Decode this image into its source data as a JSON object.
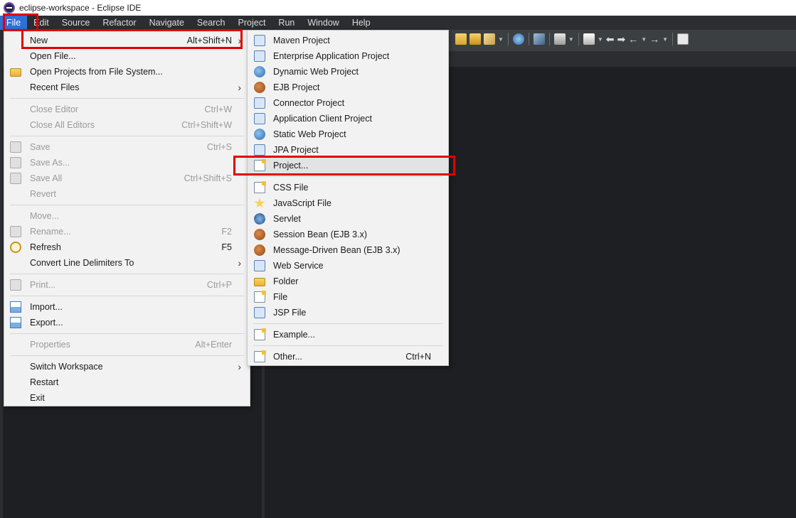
{
  "titlebar": {
    "title": "eclipse-workspace - Eclipse IDE"
  },
  "menubar": [
    "File",
    "Edit",
    "Source",
    "Refactor",
    "Navigate",
    "Search",
    "Project",
    "Run",
    "Window",
    "Help"
  ],
  "file_menu": {
    "items": [
      {
        "label": "New",
        "shortcut": "Alt+Shift+N",
        "submenu": true,
        "disabled": false,
        "icon": ""
      },
      {
        "label": "Open File...",
        "shortcut": "",
        "submenu": false,
        "disabled": false,
        "icon": ""
      },
      {
        "label": "Open Projects from File System...",
        "shortcut": "",
        "submenu": false,
        "disabled": false,
        "icon": "folder-icon"
      },
      {
        "label": "Recent Files",
        "shortcut": "",
        "submenu": true,
        "disabled": false,
        "icon": ""
      },
      {
        "label": "Close Editor",
        "shortcut": "Ctrl+W",
        "submenu": false,
        "disabled": true,
        "icon": ""
      },
      {
        "label": "Close All Editors",
        "shortcut": "Ctrl+Shift+W",
        "submenu": false,
        "disabled": true,
        "icon": ""
      },
      {
        "label": "Save",
        "shortcut": "Ctrl+S",
        "submenu": false,
        "disabled": true,
        "icon": "save-icon"
      },
      {
        "label": "Save As...",
        "shortcut": "",
        "submenu": false,
        "disabled": true,
        "icon": "save-as-icon"
      },
      {
        "label": "Save All",
        "shortcut": "Ctrl+Shift+S",
        "submenu": false,
        "disabled": true,
        "icon": "save-all-icon"
      },
      {
        "label": "Revert",
        "shortcut": "",
        "submenu": false,
        "disabled": true,
        "icon": ""
      },
      {
        "label": "Move...",
        "shortcut": "",
        "submenu": false,
        "disabled": true,
        "icon": ""
      },
      {
        "label": "Rename...",
        "shortcut": "F2",
        "submenu": false,
        "disabled": true,
        "icon": "rename-icon"
      },
      {
        "label": "Refresh",
        "shortcut": "F5",
        "submenu": false,
        "disabled": false,
        "icon": "refresh-icon"
      },
      {
        "label": "Convert Line Delimiters To",
        "shortcut": "",
        "submenu": true,
        "disabled": false,
        "icon": ""
      },
      {
        "label": "Print...",
        "shortcut": "Ctrl+P",
        "submenu": false,
        "disabled": true,
        "icon": "print-icon"
      },
      {
        "label": "Import...",
        "shortcut": "",
        "submenu": false,
        "disabled": false,
        "icon": "import-icon"
      },
      {
        "label": "Export...",
        "shortcut": "",
        "submenu": false,
        "disabled": false,
        "icon": "export-icon"
      },
      {
        "label": "Properties",
        "shortcut": "Alt+Enter",
        "submenu": false,
        "disabled": true,
        "icon": ""
      },
      {
        "label": "Switch Workspace",
        "shortcut": "",
        "submenu": true,
        "disabled": false,
        "icon": ""
      },
      {
        "label": "Restart",
        "shortcut": "",
        "submenu": false,
        "disabled": false,
        "icon": ""
      },
      {
        "label": "Exit",
        "shortcut": "",
        "submenu": false,
        "disabled": false,
        "icon": ""
      }
    ]
  },
  "new_menu": {
    "items": [
      {
        "label": "Maven Project",
        "shortcut": "",
        "icon": "maven-project-icon"
      },
      {
        "label": "Enterprise Application Project",
        "shortcut": "",
        "icon": "enterprise-application-project-icon"
      },
      {
        "label": "Dynamic Web Project",
        "shortcut": "",
        "icon": "dynamic-web-project-icon"
      },
      {
        "label": "EJB Project",
        "shortcut": "",
        "icon": "ejb-project-icon"
      },
      {
        "label": "Connector Project",
        "shortcut": "",
        "icon": "connector-project-icon"
      },
      {
        "label": "Application Client Project",
        "shortcut": "",
        "icon": "application-client-project-icon"
      },
      {
        "label": "Static Web Project",
        "shortcut": "",
        "icon": "static-web-project-icon"
      },
      {
        "label": "JPA Project",
        "shortcut": "",
        "icon": "jpa-project-icon"
      },
      {
        "label": "Project...",
        "shortcut": "",
        "icon": "project-icon"
      },
      {
        "label": "CSS File",
        "shortcut": "",
        "icon": "css-file-icon"
      },
      {
        "label": "JavaScript File",
        "shortcut": "",
        "icon": "javascript-file-icon"
      },
      {
        "label": "Servlet",
        "shortcut": "",
        "icon": "servlet-icon"
      },
      {
        "label": "Session Bean (EJB 3.x)",
        "shortcut": "",
        "icon": "session-bean-icon"
      },
      {
        "label": "Message-Driven Bean (EJB 3.x)",
        "shortcut": "",
        "icon": "message-driven-bean-icon"
      },
      {
        "label": "Web Service",
        "shortcut": "",
        "icon": "web-service-icon"
      },
      {
        "label": "Folder",
        "shortcut": "",
        "icon": "folder-icon"
      },
      {
        "label": "File",
        "shortcut": "",
        "icon": "file-icon"
      },
      {
        "label": "JSP File",
        "shortcut": "",
        "icon": "jsp-file-icon"
      },
      {
        "label": "Example...",
        "shortcut": "",
        "icon": "example-icon"
      },
      {
        "label": "Other...",
        "shortcut": "Ctrl+N",
        "icon": "other-icon"
      }
    ]
  },
  "colors": {
    "highlight": "#e00000",
    "menubar_active": "#2f6fd6",
    "menu_bg": "#f2f2f2",
    "editor_bg": "#1e1f22"
  }
}
